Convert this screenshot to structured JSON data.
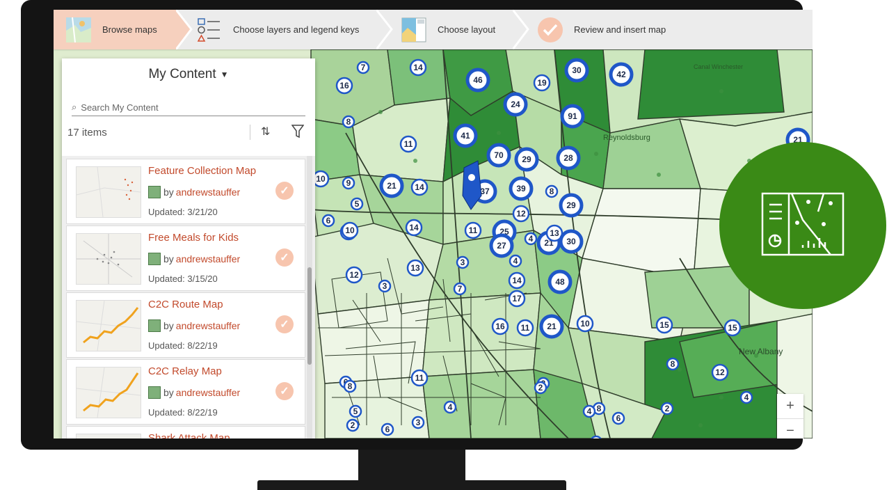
{
  "wizard": {
    "steps": [
      {
        "label": "Browse maps",
        "icon": "map-thumbnail-icon",
        "active": true
      },
      {
        "label": "Choose layers and legend keys",
        "icon": "legend-shapes-icon",
        "active": false
      },
      {
        "label": "Choose layout",
        "icon": "layout-icon",
        "active": false
      },
      {
        "label": "Review and insert map",
        "icon": "checkmark-circle-icon",
        "active": false
      }
    ]
  },
  "panel": {
    "title": "My Content",
    "search_placeholder": "Search My Content",
    "count": "17 items",
    "items": [
      {
        "title": "Feature Collection Map",
        "by": "by",
        "author": "andrewstauffer",
        "updated": "Updated: 3/21/20"
      },
      {
        "title": "Free Meals for Kids",
        "by": "by",
        "author": "andrewstauffer",
        "updated": "Updated: 3/15/20"
      },
      {
        "title": "C2C Route Map",
        "by": "by",
        "author": "andrewstauffer",
        "updated": "Updated: 8/22/19"
      },
      {
        "title": "C2C Relay Map",
        "by": "by",
        "author": "andrewstauffer",
        "updated": "Updated: 8/22/19"
      },
      {
        "title": "Shark Attack Map",
        "by": "",
        "author": "",
        "updated": ""
      }
    ]
  },
  "map": {
    "place_labels": [
      "Reynoldsburg",
      "New Albany",
      "Canal Winchester"
    ],
    "cluster_counts": [
      "7",
      "14",
      "16",
      "46",
      "19",
      "30",
      "42",
      "24",
      "91",
      "8",
      "41",
      "11",
      "70",
      "29",
      "28",
      "21",
      "10",
      "9",
      "21",
      "14",
      "10",
      "37",
      "39",
      "8",
      "29",
      "12",
      "5",
      "6",
      "10",
      "14",
      "11",
      "25",
      "27",
      "4",
      "21",
      "13",
      "30",
      "12",
      "3",
      "4",
      "13",
      "14",
      "48",
      "3",
      "7",
      "17",
      "16",
      "11",
      "21",
      "10",
      "15",
      "15",
      "8",
      "12",
      "4",
      "2",
      "8",
      "4",
      "6",
      "5",
      "6",
      "11",
      "8",
      "3",
      "2",
      "4",
      "3",
      "2",
      "5",
      "6"
    ]
  },
  "zoom": {
    "in": "+",
    "out": "−"
  },
  "colors": {
    "accent": "#3a8a16",
    "active_step": "#f6d0be",
    "link": "#c24a2c",
    "cluster": "#1f57c8"
  }
}
